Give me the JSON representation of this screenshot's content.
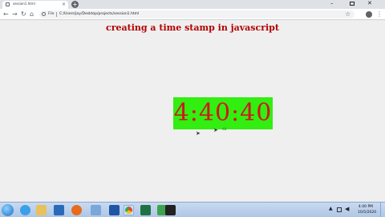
{
  "browser": {
    "tab_title": "session1.html",
    "tab_close": "×",
    "new_tab": "+",
    "file_label": "File",
    "url": "C:/Users/joy/Desktop/projects/session1.html",
    "window_min": "–",
    "window_close": "✕",
    "nav_back": "←",
    "nav_forward": "→",
    "nav_reload": "↻",
    "nav_home": "⌂",
    "star": "☆",
    "menu": "⋮"
  },
  "page": {
    "heading": "creating a time stamp in javascript",
    "clock": "4:40:40",
    "heading_color": "#b30000",
    "clock_color": "#cc1a1a",
    "clock_bg": "#33ee11"
  },
  "taskbar": {
    "icons": [
      "start-orb-icon",
      "ie-icon",
      "folder-icon",
      "media-player-icon",
      "firefox-icon",
      "notepad-icon",
      "word-icon",
      "chrome-icon",
      "excel-icon",
      "green-app-icon",
      "terminal-icon"
    ],
    "time": "4:40 PM",
    "date": "10/5/2020"
  }
}
